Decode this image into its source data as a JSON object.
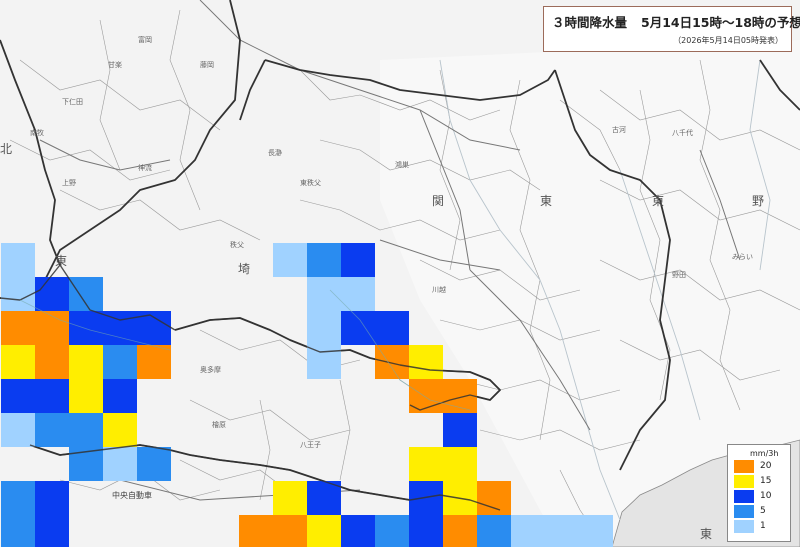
{
  "title": {
    "main": "３時間降水量",
    "period": "5月14日15時～18時の予想",
    "issued": "（2026年5月14日05時発表）"
  },
  "legend": {
    "unit": "mm/3h",
    "items": [
      {
        "label": "20",
        "color": "#ff8c00"
      },
      {
        "label": "15",
        "color": "#ffee00"
      },
      {
        "label": "10",
        "color": "#0a3cf0"
      },
      {
        "label": "5",
        "color": "#2a8cf0"
      },
      {
        "label": "1",
        "color": "#a0d2ff"
      }
    ]
  },
  "colors": {
    "c20": "#ff8c00",
    "c15": "#ffee00",
    "c10": "#0a3cf0",
    "c5": "#2a8cf0",
    "c1": "#a0d2ff"
  },
  "places": [
    {
      "text": "下仁田",
      "id": "shimonita"
    },
    {
      "text": "南牧",
      "id": "nanmoku"
    },
    {
      "text": "上野",
      "id": "ueno"
    },
    {
      "text": "神流",
      "id": "kanna"
    },
    {
      "text": "甘楽",
      "id": "kanra"
    },
    {
      "text": "富岡",
      "id": "tomioka"
    },
    {
      "text": "藤岡",
      "id": "fujioka"
    },
    {
      "text": "長瀞",
      "id": "nagatoro"
    },
    {
      "text": "東秩父",
      "id": "higashichichibu"
    },
    {
      "text": "秩父",
      "id": "chichibu"
    },
    {
      "text": "奥多摩",
      "id": "okutama"
    },
    {
      "text": "檜原",
      "id": "hinohara"
    },
    {
      "text": "八王子",
      "id": "hachioji"
    },
    {
      "text": "鴻巣",
      "id": "konosu"
    },
    {
      "text": "川越",
      "id": "kawagoe"
    },
    {
      "text": "古河",
      "id": "koga"
    },
    {
      "text": "八千代",
      "id": "yachiyo"
    },
    {
      "text": "野田",
      "id": "noda"
    },
    {
      "text": "みらい",
      "id": "mirai"
    },
    {
      "text": "東",
      "id": "higashi1"
    },
    {
      "text": "埼",
      "id": "sai"
    },
    {
      "text": "東",
      "id": "higashi2"
    },
    {
      "text": "関",
      "id": "seki"
    },
    {
      "text": "東",
      "id": "higashi3"
    },
    {
      "text": "野",
      "id": "no"
    },
    {
      "text": "北",
      "id": "kita"
    },
    {
      "text": "東",
      "id": "higashi4"
    },
    {
      "text": "中央自動車",
      "id": "chuo"
    }
  ],
  "precip_cells": [
    {
      "c": 0,
      "r": 7,
      "v": 1
    },
    {
      "c": 0,
      "r": 8,
      "v": 1
    },
    {
      "c": 1,
      "r": 8,
      "v": 10
    },
    {
      "c": 2,
      "r": 8,
      "v": 5
    },
    {
      "c": 0,
      "r": 9,
      "v": 20
    },
    {
      "c": 1,
      "r": 9,
      "v": 20
    },
    {
      "c": 2,
      "r": 9,
      "v": 10
    },
    {
      "c": 3,
      "r": 9,
      "v": 10
    },
    {
      "c": 4,
      "r": 9,
      "v": 10
    },
    {
      "c": 0,
      "r": 10,
      "v": 15
    },
    {
      "c": 1,
      "r": 10,
      "v": 20
    },
    {
      "c": 2,
      "r": 10,
      "v": 15
    },
    {
      "c": 3,
      "r": 10,
      "v": 5
    },
    {
      "c": 4,
      "r": 10,
      "v": 20
    },
    {
      "c": 0,
      "r": 11,
      "v": 10
    },
    {
      "c": 1,
      "r": 11,
      "v": 10
    },
    {
      "c": 2,
      "r": 11,
      "v": 15
    },
    {
      "c": 3,
      "r": 11,
      "v": 10
    },
    {
      "c": 0,
      "r": 12,
      "v": 1
    },
    {
      "c": 1,
      "r": 12,
      "v": 5
    },
    {
      "c": 2,
      "r": 12,
      "v": 5
    },
    {
      "c": 3,
      "r": 12,
      "v": 15
    },
    {
      "c": 2,
      "r": 13,
      "v": 5
    },
    {
      "c": 3,
      "r": 13,
      "v": 1
    },
    {
      "c": 4,
      "r": 13,
      "v": 5
    },
    {
      "c": 0,
      "r": 14,
      "v": 5
    },
    {
      "c": 1,
      "r": 14,
      "v": 10
    },
    {
      "c": 0,
      "r": 15,
      "v": 5
    },
    {
      "c": 1,
      "r": 15,
      "v": 10
    },
    {
      "c": 8,
      "r": 7,
      "v": 1
    },
    {
      "c": 9,
      "r": 7,
      "v": 5
    },
    {
      "c": 10,
      "r": 7,
      "v": 10
    },
    {
      "c": 9,
      "r": 8,
      "v": 1
    },
    {
      "c": 10,
      "r": 8,
      "v": 1
    },
    {
      "c": 9,
      "r": 9,
      "v": 1
    },
    {
      "c": 10,
      "r": 9,
      "v": 10
    },
    {
      "c": 11,
      "r": 9,
      "v": 10
    },
    {
      "c": 9,
      "r": 10,
      "v": 1
    },
    {
      "c": 11,
      "r": 10,
      "v": 20
    },
    {
      "c": 12,
      "r": 10,
      "v": 15
    },
    {
      "c": 12,
      "r": 11,
      "v": 20
    },
    {
      "c": 13,
      "r": 11,
      "v": 20
    },
    {
      "c": 13,
      "r": 12,
      "v": 10
    },
    {
      "c": 12,
      "r": 13,
      "v": 15
    },
    {
      "c": 13,
      "r": 13,
      "v": 15
    },
    {
      "c": 12,
      "r": 14,
      "v": 10
    },
    {
      "c": 13,
      "r": 14,
      "v": 15
    },
    {
      "c": 14,
      "r": 14,
      "v": 20
    },
    {
      "c": 8,
      "r": 14,
      "v": 15
    },
    {
      "c": 9,
      "r": 14,
      "v": 10
    },
    {
      "c": 7,
      "r": 15,
      "v": 20
    },
    {
      "c": 8,
      "r": 15,
      "v": 20
    },
    {
      "c": 9,
      "r": 15,
      "v": 15
    },
    {
      "c": 10,
      "r": 15,
      "v": 10
    },
    {
      "c": 11,
      "r": 15,
      "v": 5
    },
    {
      "c": 12,
      "r": 15,
      "v": 10
    },
    {
      "c": 13,
      "r": 15,
      "v": 20
    },
    {
      "c": 14,
      "r": 15,
      "v": 5
    },
    {
      "c": 15,
      "r": 15,
      "v": 1
    },
    {
      "c": 16,
      "r": 15,
      "v": 1
    },
    {
      "c": 17,
      "r": 15,
      "v": 1
    }
  ]
}
